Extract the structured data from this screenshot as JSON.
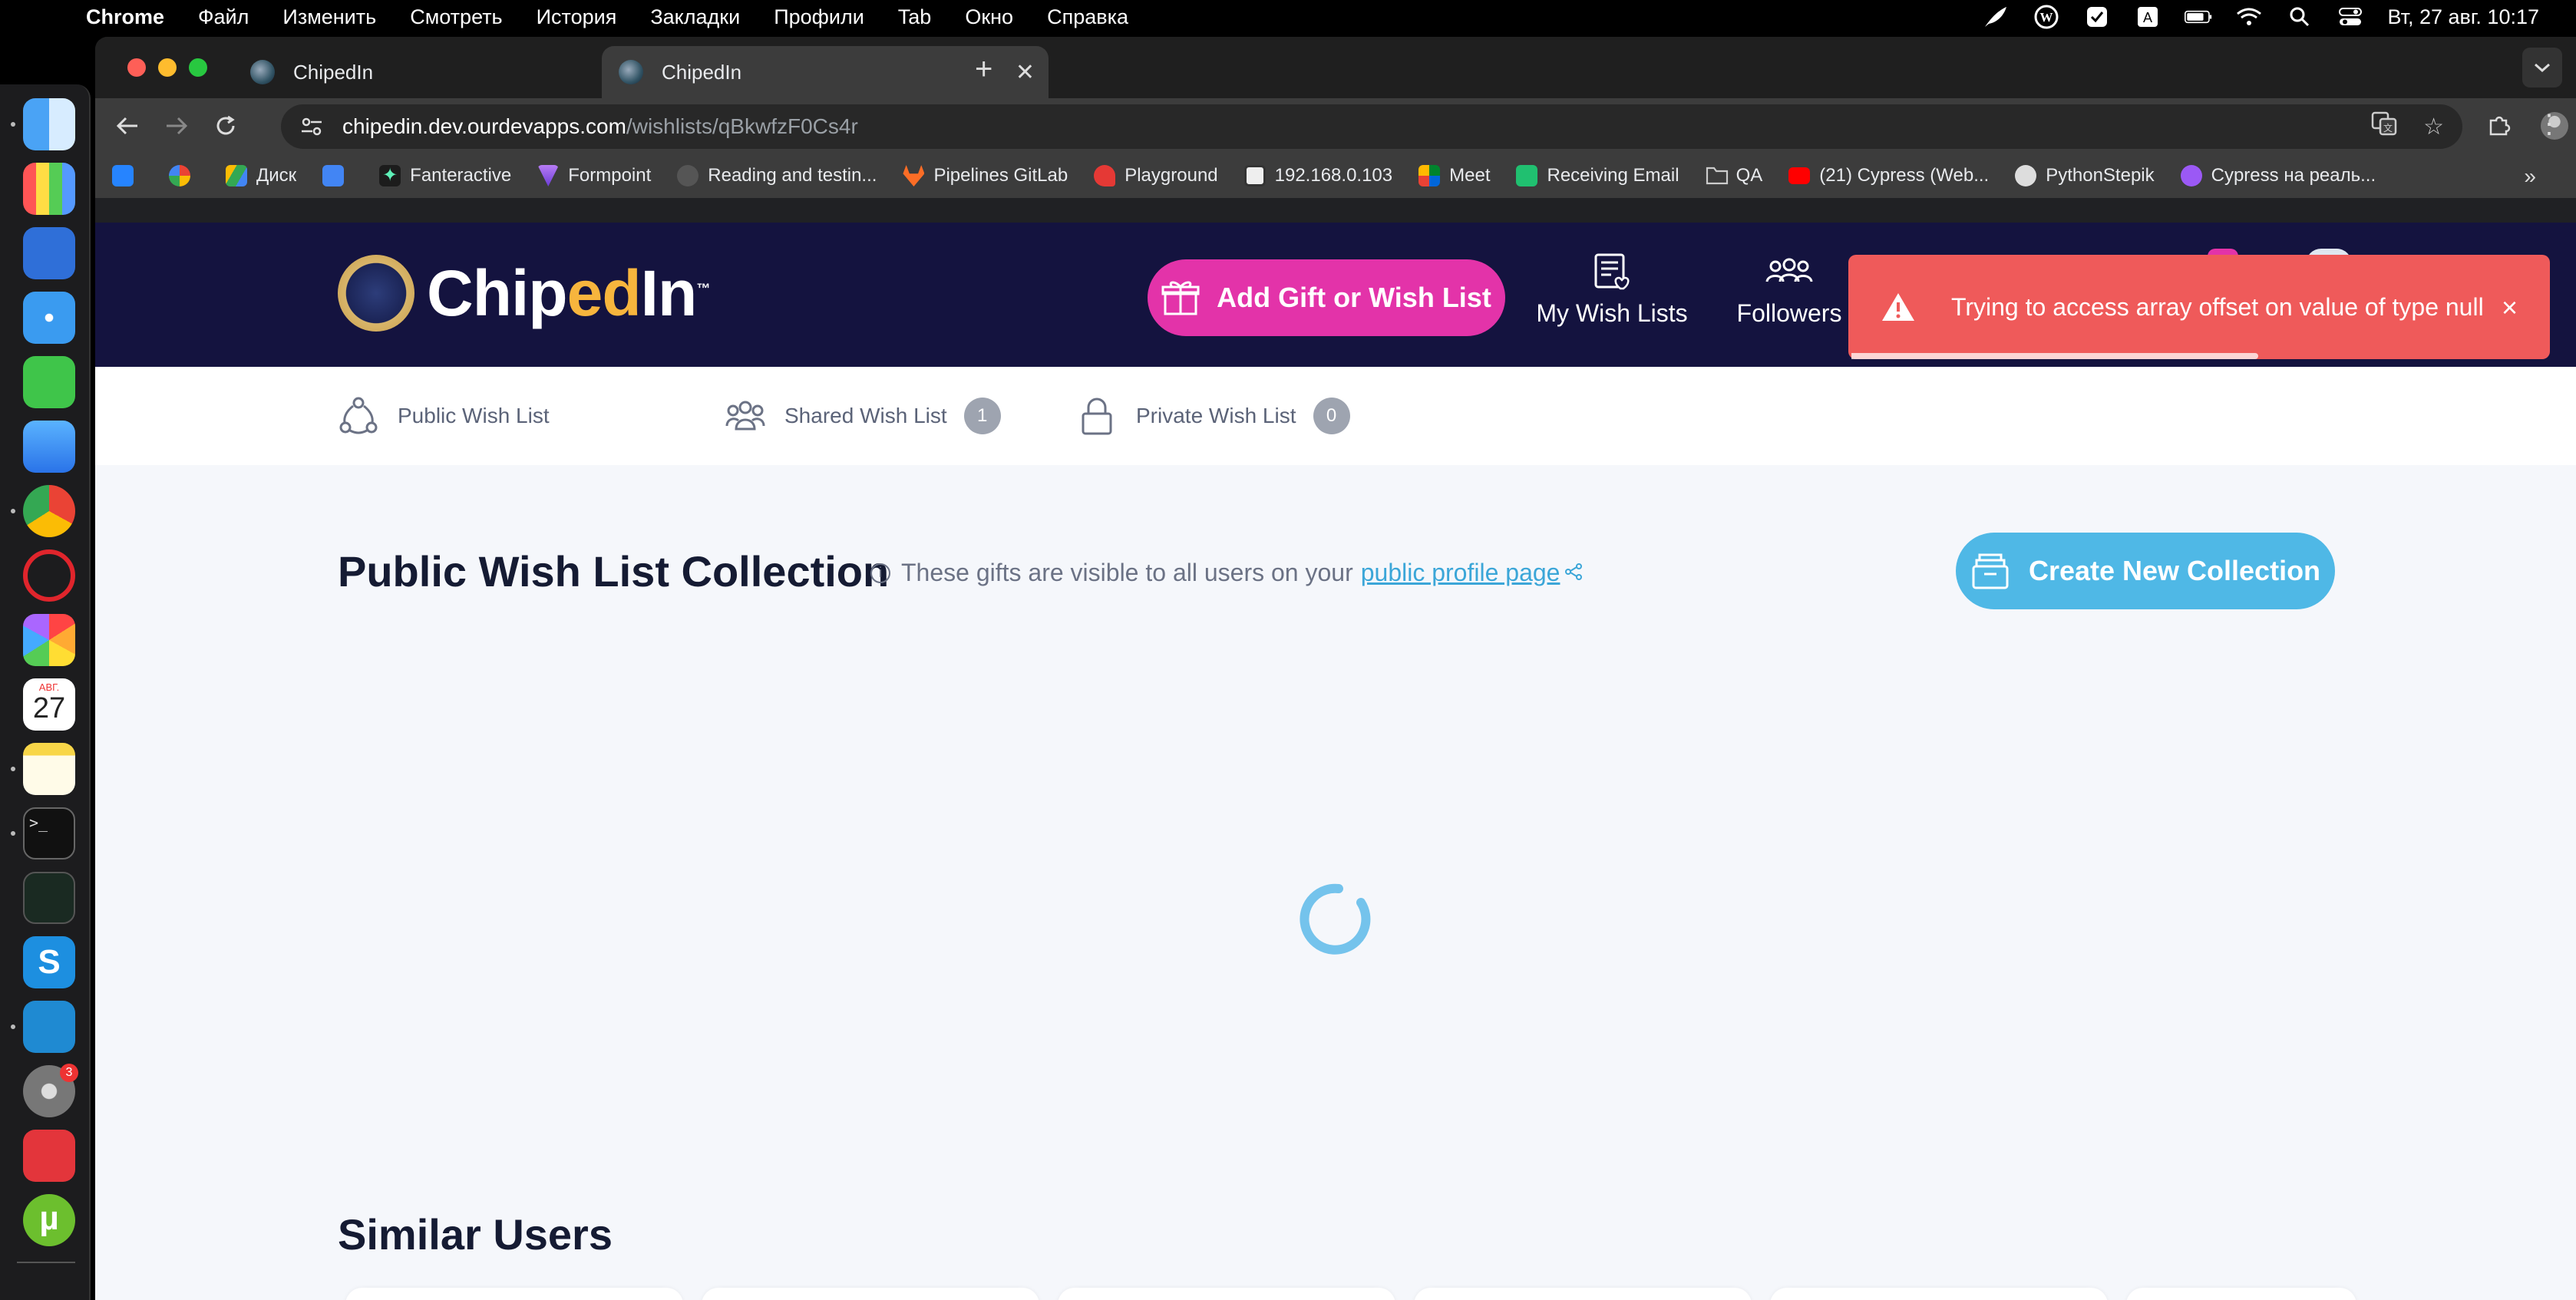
{
  "menubar": {
    "app": "Chrome",
    "items": [
      "Файл",
      "Изменить",
      "Смотреть",
      "История",
      "Закладки",
      "Профили",
      "Tab",
      "Окно",
      "Справка"
    ],
    "clock": "Вт, 27 авг.  10:17"
  },
  "dock": {
    "calendar_month": "АВГ.",
    "calendar_day": "27",
    "settings_badge": "3"
  },
  "browser": {
    "tabs": [
      {
        "title": "ChipedIn"
      },
      {
        "title": "ChipedIn"
      }
    ],
    "url_host": "chipedin.dev.ourdevapps.com",
    "url_path": "/wishlists/qBkwfzF0Cs4r",
    "bookmarks": [
      "Диск",
      "Fanteractive",
      "Formpoint",
      "Reading and testin...",
      "Pipelines GitLab",
      "Playground",
      "192.168.0.103",
      "Meet",
      "Receiving Email",
      "QA",
      "(21) Cypress (Web...",
      "PythonStepik",
      "Cypress на реаль..."
    ]
  },
  "header": {
    "logo_text_a": "Chip",
    "logo_text_b": "ed",
    "logo_text_c": "In",
    "logo_tm": "™",
    "add_gift_label": "Add Gift or Wish List",
    "my_wish_lists_label": "My Wish Lists",
    "followers_label": "Followers"
  },
  "toast": {
    "message": "Trying to access array offset on value of type null",
    "close": "×",
    "progress_fraction": 0.58
  },
  "wishlist_tabs": [
    {
      "label": "Public Wish List",
      "count": null
    },
    {
      "label": "Shared Wish List",
      "count": "1"
    },
    {
      "label": "Private Wish List",
      "count": "0"
    }
  ],
  "collection": {
    "title": "Public Wish List Collection",
    "info_text": "These gifts are visible to all users on your",
    "info_link": "public profile page",
    "create_label": "Create New Collection"
  },
  "similar_users": {
    "title": "Similar Users"
  },
  "colors": {
    "header_bg": "#14133f",
    "accent_pink": "#e333a9",
    "accent_blue": "#4fb8e6",
    "toast_red": "#ef5a5a"
  }
}
